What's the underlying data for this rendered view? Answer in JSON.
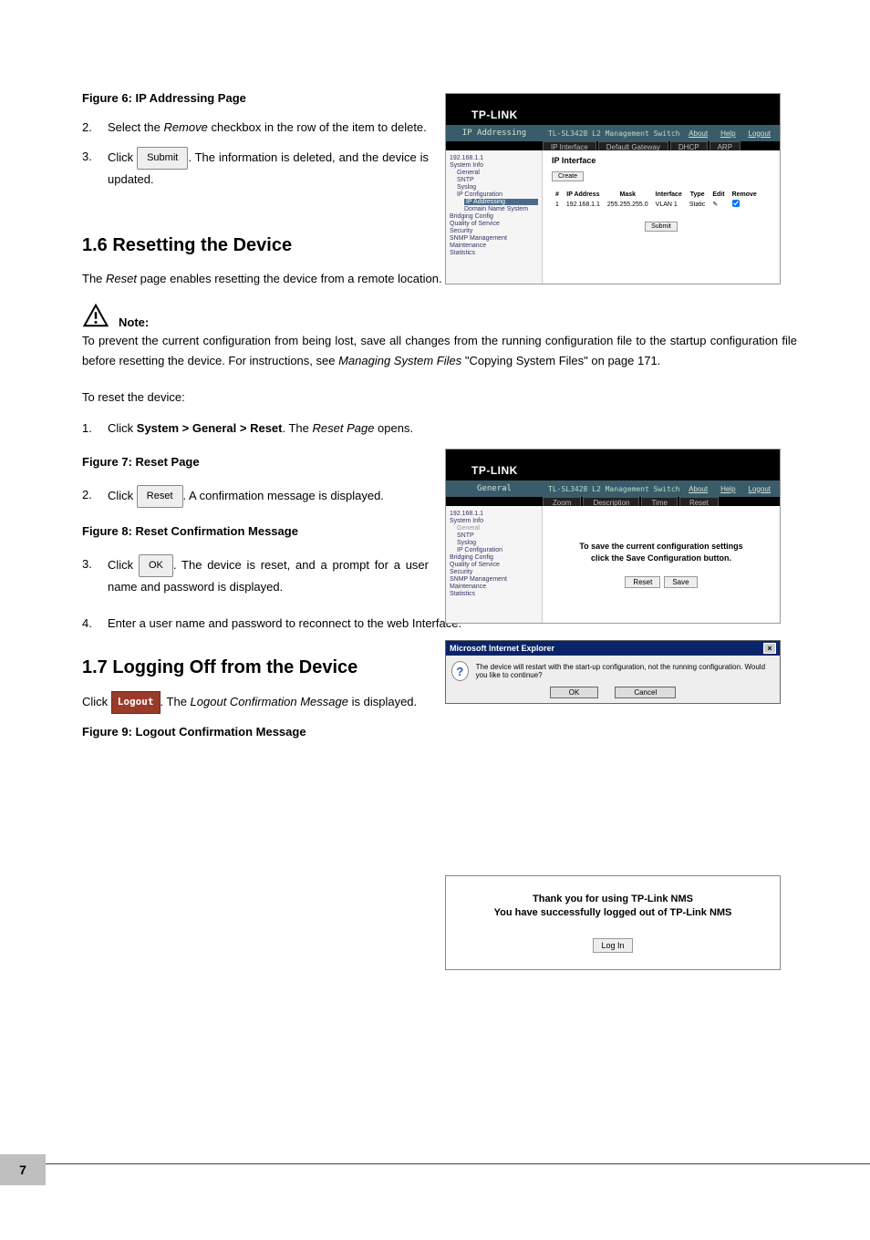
{
  "figure6": {
    "caption": "Figure 6: IP Addressing Page",
    "logo": "TP-LINK",
    "crumb": "IP Addressing",
    "switch_title": "TL-SL3428 L2 Management Switch",
    "link_about": "About",
    "link_help": "Help",
    "link_logout": "Logout",
    "tabs": [
      "IP Interface",
      "Default Gateway",
      "DHCP",
      "ARP"
    ],
    "tree": {
      "ip": "192.168.1.1",
      "n1": "System Info",
      "n1a": "General",
      "n1b": "SNTP",
      "n1c": "Syslog",
      "n2": "IP Configuration",
      "n2a": "IP Addressing",
      "n2b": "Domain Name System",
      "n3": "Bridging Config",
      "n4": "Quality of Service",
      "n5": "Security",
      "n6": "SNMP Management",
      "n7": "Maintenance",
      "n8": "Statistics"
    },
    "main_heading": "IP Interface",
    "create_btn": "Create",
    "th": [
      "#",
      "IP Address",
      "Mask",
      "Interface",
      "Type",
      "Edit",
      "Remove"
    ],
    "row": [
      "1",
      "192.168.1.1",
      "255.255.255.0",
      "VLAN 1",
      "Static",
      "✎",
      ""
    ],
    "submit_btn": "Submit"
  },
  "steps_a": {
    "s2_pre": "Select the ",
    "s2_em": "Remove",
    "s2_post": " checkbox in the row of the item to delete.",
    "s3_pre": "Click ",
    "s3_btn": "Submit",
    "s3_post": ". The information is deleted, and the device is updated."
  },
  "sec16_heading": "1.6   Resetting the Device",
  "sec16_p1_a": "The ",
  "sec16_p1_em": "Reset",
  "sec16_p1_b": " page enables resetting the device from a remote location.",
  "note_label": "Note:",
  "note_body_a": "To prevent the current configuration from being lost, save all changes from the running configuration file to the startup configuration file before resetting the device. For instructions, see ",
  "note_body_em": "Managing System Files",
  "note_body_b": " \"Copying System Files\" on page 171.",
  "reset_intro": "To reset the device:",
  "steps_b": {
    "s1_pre": "Click ",
    "s1_bold": "System > General > Reset",
    "s1_mid": ". The ",
    "s1_em": "Reset Page",
    "s1_post": " opens."
  },
  "figure7": {
    "caption": "Figure 7: Reset Page",
    "logo": "TP-LINK",
    "crumb": "General",
    "switch_title": "TL-SL3428 L2 Management Switch",
    "link_about": "About",
    "link_help": "Help",
    "link_logout": "Logout",
    "tabs": [
      "Zoom",
      "Description",
      "Time",
      "Reset"
    ],
    "tree": {
      "ip": "192.168.1.1",
      "n1": "System Info",
      "n1a": "General",
      "n1b": "SNTP",
      "n1c": "Syslog",
      "n1d": "IP Configuration",
      "n2": "Bridging Config",
      "n3": "Quality of Service",
      "n4": "Security",
      "n5": "SNMP Management",
      "n6": "Maintenance",
      "n7": "Statistics"
    },
    "msg1": "To save the current configuration settings",
    "msg2": "click the Save Configuration button.",
    "btn_reset": "Reset",
    "btn_save": "Save"
  },
  "steps_c": {
    "s2_pre": "Click ",
    "s2_btn": "Reset",
    "s2_post": ". A confirmation message is displayed."
  },
  "figure8": {
    "caption": "Figure 8: Reset Confirmation Message",
    "titlebar": "Microsoft Internet Explorer",
    "close": "×",
    "msg": "The device will restart with the start-up configuration, not the running configuration. Would you like to continue?",
    "ok": "OK",
    "cancel": "Cancel"
  },
  "steps_d": {
    "s3_pre": "Click ",
    "s3_btn": "OK",
    "s3_post": ". The device is reset, and a prompt for a user name and password is displayed.",
    "s4": "Enter a user name and password to reconnect to the web Interface."
  },
  "sec17_heading": "1.7   Logging Off from the Device",
  "sec17_p_a": "Click ",
  "sec17_btn": "Logout",
  "sec17_p_b": ". The ",
  "sec17_p_em": "Logout Confirmation Message",
  "sec17_p_c": " is displayed.",
  "figure9": {
    "caption": "Figure 9: Logout Confirmation Message",
    "line1": "Thank you for using TP-Link NMS",
    "line2": "You have successfully logged out of TP-Link NMS",
    "btn": "Log In"
  },
  "page_number": "7"
}
